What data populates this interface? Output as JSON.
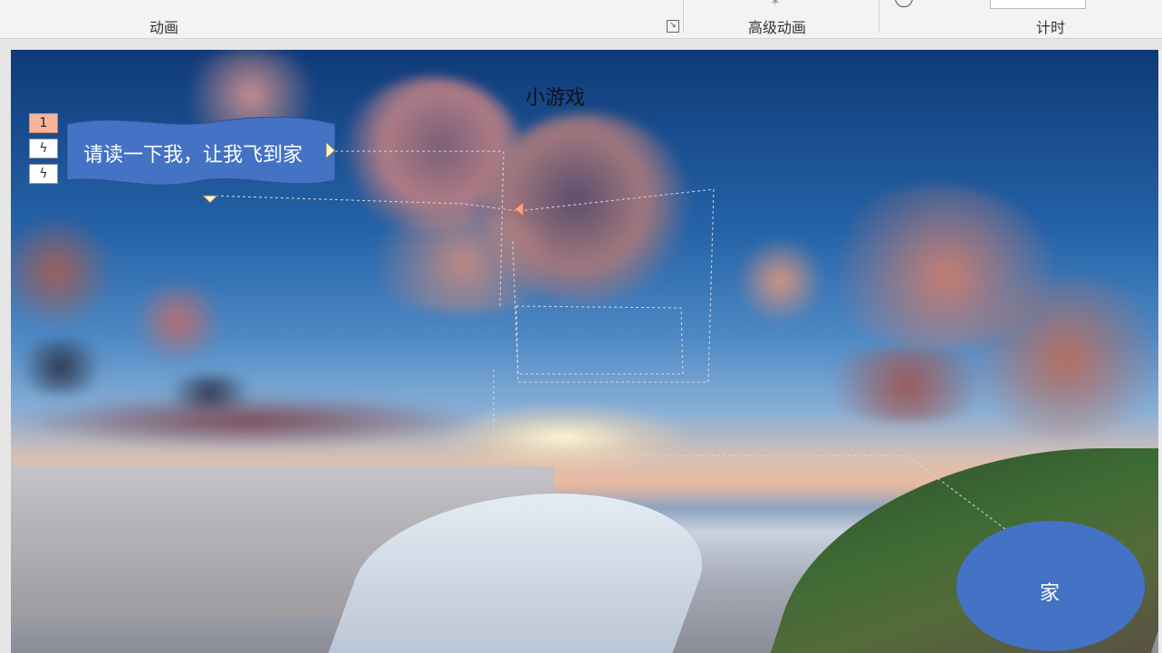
{
  "ribbon": {
    "groups": [
      "动画",
      "高级动画",
      "计时"
    ]
  },
  "slide": {
    "title": "小游戏",
    "animation_tags": [
      "1",
      "ϟ",
      "ϟ"
    ],
    "banner_text": "请读一下我，让我飞到家",
    "home_label": "家"
  },
  "colors": {
    "banner_fill": "#4472c4",
    "home_fill": "#4472c4",
    "animation_tag_accent": "#f7b49b"
  }
}
